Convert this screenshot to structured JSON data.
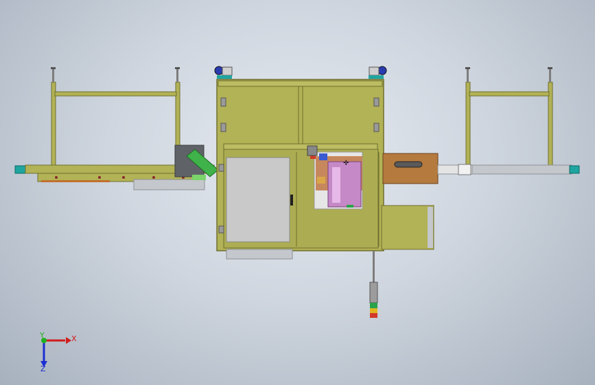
{
  "viewport": {
    "background_top": "#e6eaf0",
    "background_bottom": "#a7b1be"
  },
  "model": {
    "frame_color": "#b2b256",
    "frame_edge": "#6f6f2e",
    "panel_gray": "#c9c9c9",
    "conveyor_gray": "#c4c7cb",
    "teal_accent": "#1fa5a0",
    "wood_color": "#b47a3e",
    "plc_board_color": "#c489c6",
    "signal_tower": [
      "#9c9c9c",
      "#2aa34a",
      "#e3b620",
      "#d23a2a"
    ]
  },
  "axis_triad": {
    "x_label": "X",
    "y_label": "Y",
    "z_label": "Z",
    "x_color": "#d11b1b",
    "y_color": "#20b020",
    "z_color": "#1c2fd1"
  }
}
